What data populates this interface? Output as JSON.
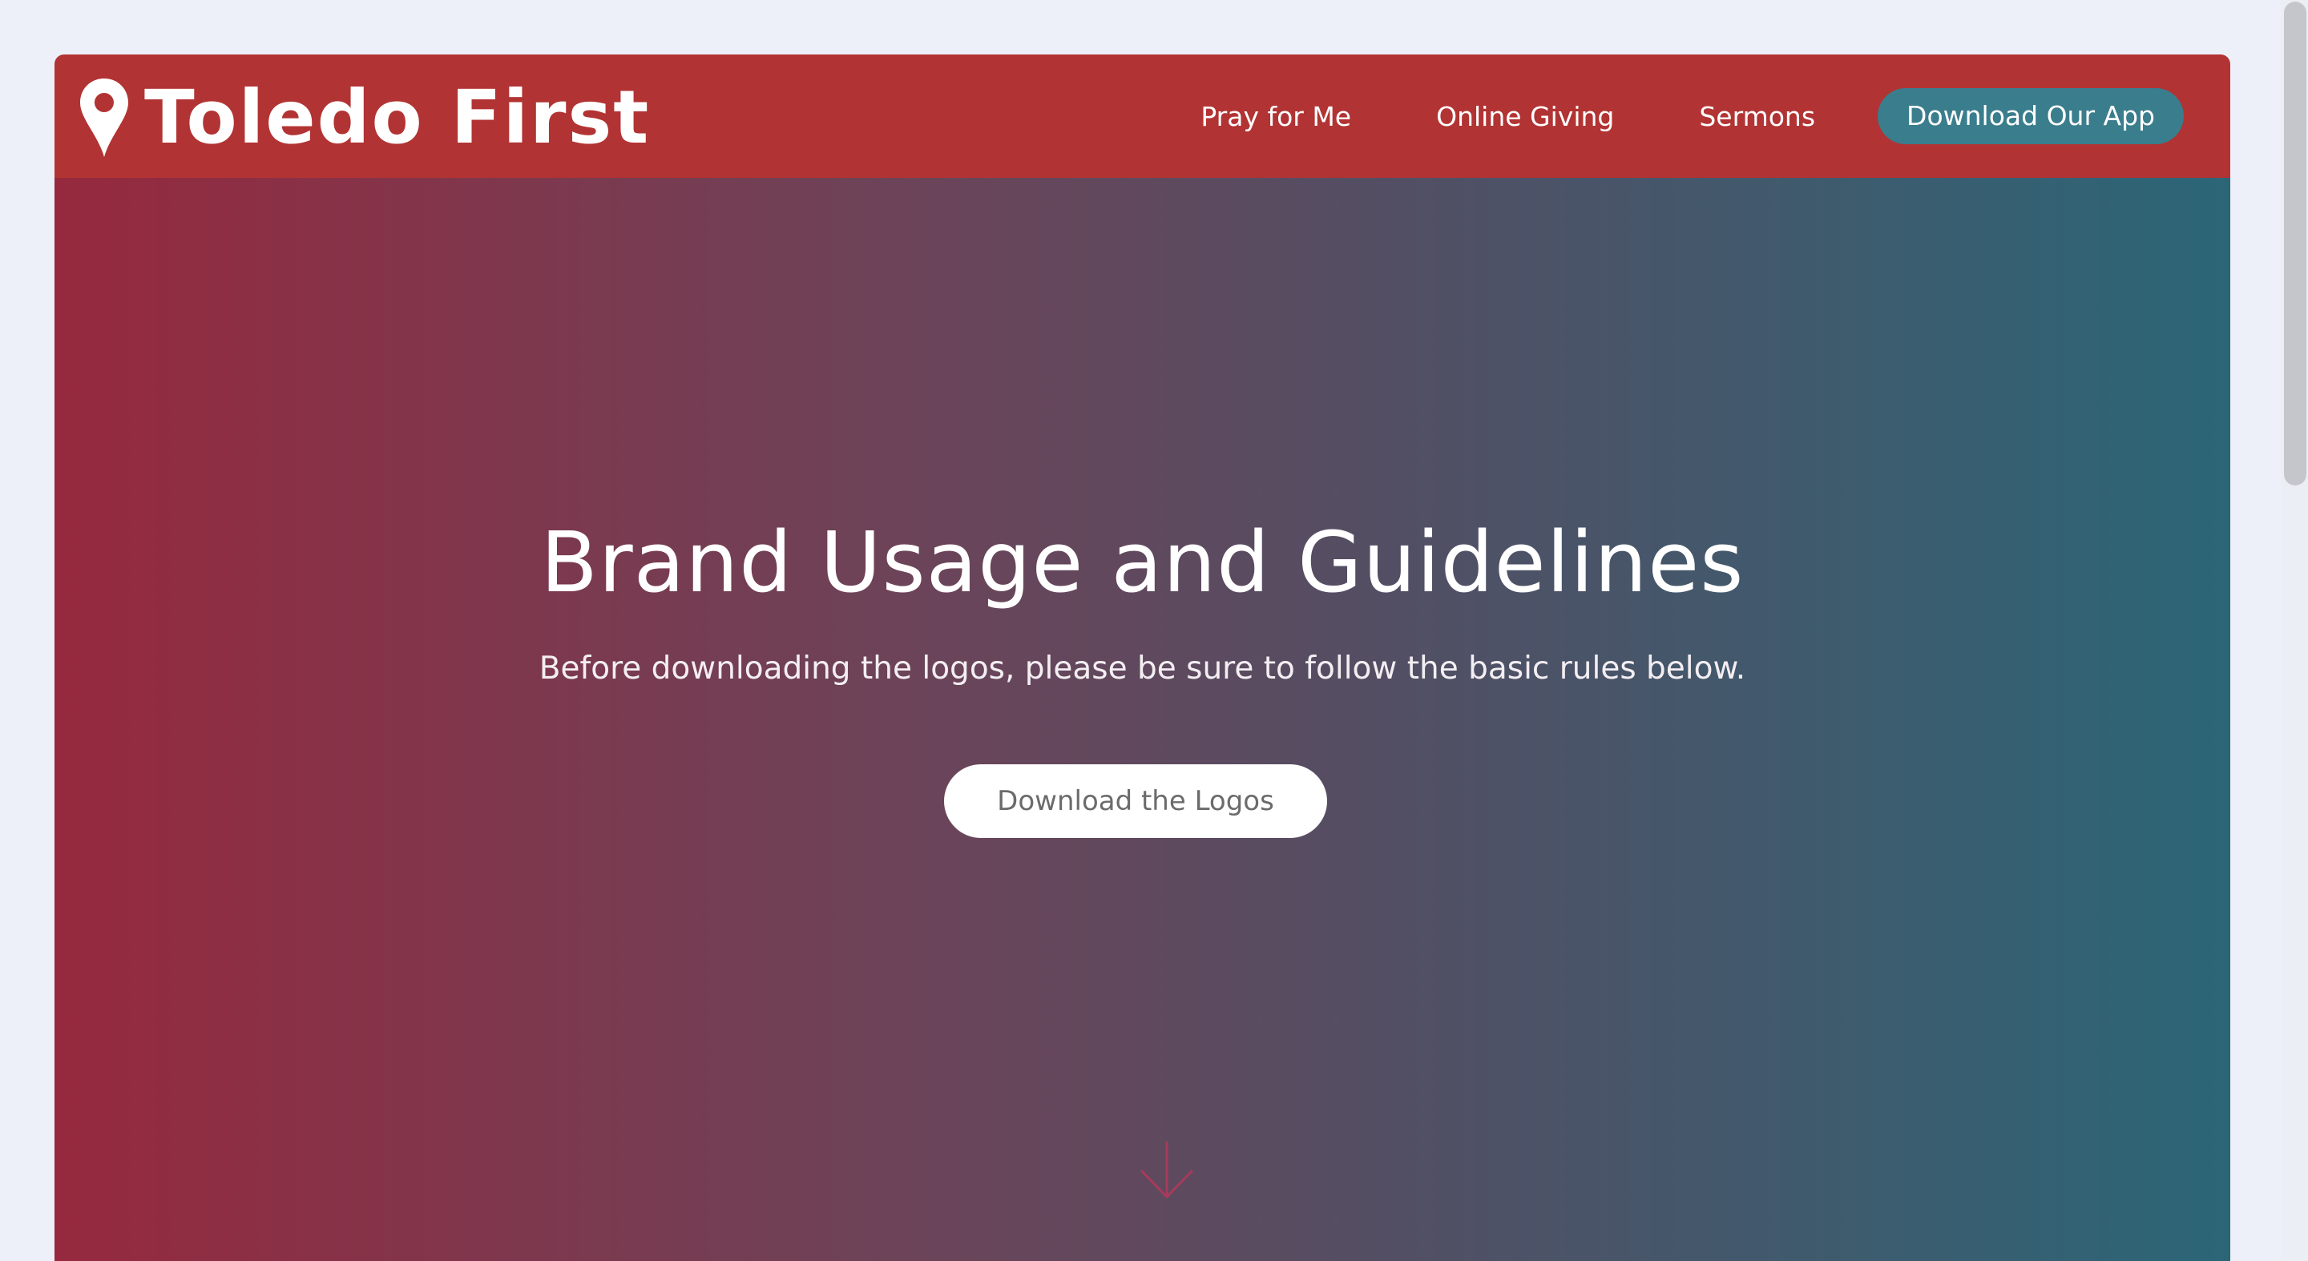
{
  "brand": {
    "name": "Toledo First",
    "icon": "map-pin-icon"
  },
  "nav": {
    "links": [
      "Pray for Me",
      "Online Giving",
      "Sermons"
    ],
    "cta_label": "Download Our App"
  },
  "hero": {
    "title": "Brand Usage and Guidelines",
    "subtitle": "Before downloading the logos, please be sure to follow the basic rules below.",
    "button_label": "Download the Logos",
    "scroll_icon": "arrow-down-icon"
  },
  "colors": {
    "navbar": "#b23333",
    "cta": "#3a7d8c",
    "gradient_start": "#96293e",
    "gradient_end": "#2b6677",
    "page_background": "#edf0f8"
  }
}
